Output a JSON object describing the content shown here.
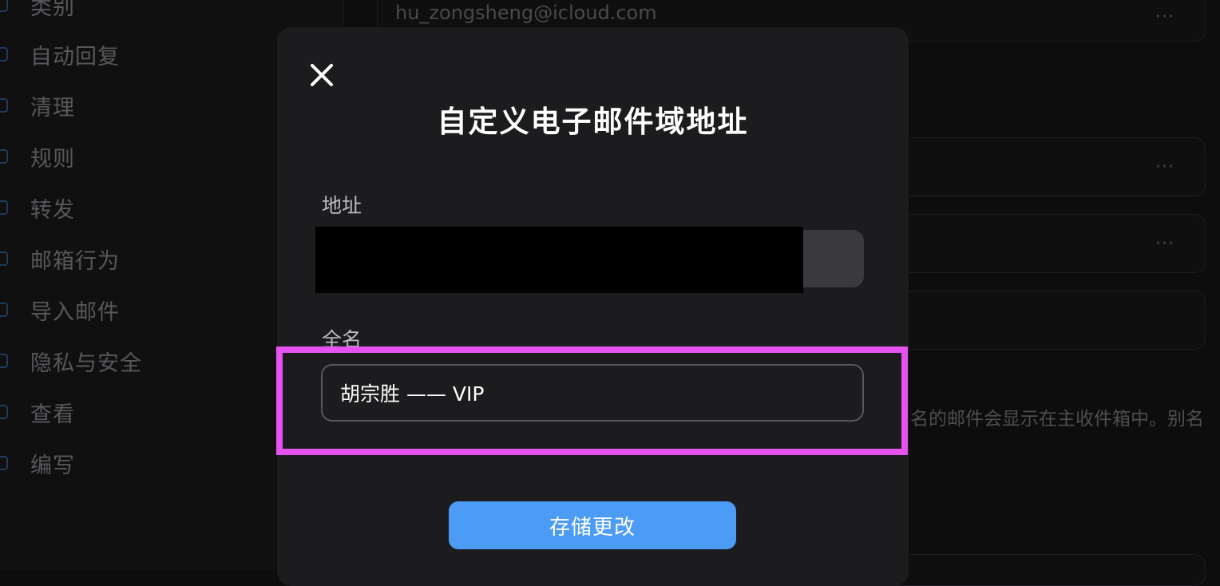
{
  "sidebar": {
    "items": [
      {
        "label": "类别"
      },
      {
        "label": "自动回复"
      },
      {
        "label": "清理"
      },
      {
        "label": "规则"
      },
      {
        "label": "转发"
      },
      {
        "label": "邮箱行为"
      },
      {
        "label": "导入邮件"
      },
      {
        "label": "隐私与安全"
      },
      {
        "label": "查看"
      },
      {
        "label": "编写"
      }
    ]
  },
  "background": {
    "email": "hu_zongsheng@icloud.com",
    "more_label": "···",
    "note": "名的邮件会显示在主收件箱中。别名"
  },
  "modal": {
    "title": "自定义电子邮件域地址",
    "address_label": "地址",
    "fullname_label": "全名",
    "fullname_value": "胡宗胜 —— VIP",
    "save_label": "存储更改"
  },
  "colors": {
    "modal_bg": "#1c1c1e",
    "accent": "#4c9bf4",
    "highlight": "#e652f0"
  }
}
